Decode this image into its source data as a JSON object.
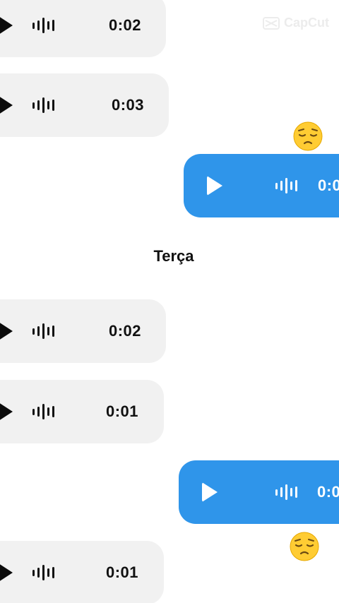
{
  "watermark": {
    "text": "CapCut"
  },
  "messages": [
    {
      "direction": "in",
      "duration": "0:02"
    },
    {
      "direction": "in",
      "duration": "0:03"
    },
    {
      "direction": "out",
      "duration": "0:0",
      "reaction": "pensive-face-emoji"
    },
    {
      "direction": "in",
      "duration": "0:02"
    },
    {
      "direction": "in",
      "duration": "0:01"
    },
    {
      "direction": "out",
      "duration": "0:0",
      "reaction": "pensive-face-emoji"
    },
    {
      "direction": "in",
      "duration": "0:01"
    }
  ],
  "day_separator": {
    "label": "Terça"
  },
  "colors": {
    "incoming_bubble": "#f1f1f1",
    "outgoing_bubble": "#2f95ea",
    "text": "#111111"
  }
}
